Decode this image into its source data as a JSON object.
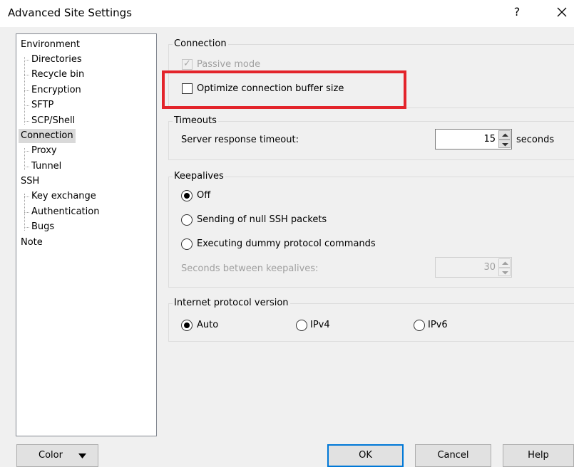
{
  "window": {
    "title": "Advanced Site Settings",
    "help_glyph": "?"
  },
  "tree": {
    "items": [
      "Environment",
      "Directories",
      "Recycle bin",
      "Encryption",
      "SFTP",
      "SCP/Shell",
      "Connection",
      "Proxy",
      "Tunnel",
      "SSH",
      "Key exchange",
      "Authentication",
      "Bugs",
      "Note"
    ],
    "selected": "Connection"
  },
  "connection": {
    "title": "Connection",
    "passive_mode": {
      "label": "Passive mode",
      "checked": true,
      "disabled": true
    },
    "optimize_buffer": {
      "label": "Optimize connection buffer size",
      "checked": false
    }
  },
  "timeouts": {
    "title": "Timeouts",
    "server_response_label": "Server response timeout:",
    "server_response_value": "15",
    "unit": "seconds"
  },
  "keepalives": {
    "title": "Keepalives",
    "options": [
      "Off",
      "Sending of null SSH packets",
      "Executing dummy protocol commands"
    ],
    "selected": "Off",
    "seconds_label": "Seconds between keepalives:",
    "seconds_value": "30"
  },
  "ip_version": {
    "title": "Internet protocol version",
    "options": [
      "Auto",
      "IPv4",
      "IPv6"
    ],
    "selected": "Auto"
  },
  "buttons": {
    "color": "Color",
    "ok": "OK",
    "cancel": "Cancel",
    "help": "Help"
  },
  "colors": {
    "highlight": "#e3242b",
    "default_button_border": "#0078d7",
    "selection": "#d9d9d9"
  }
}
